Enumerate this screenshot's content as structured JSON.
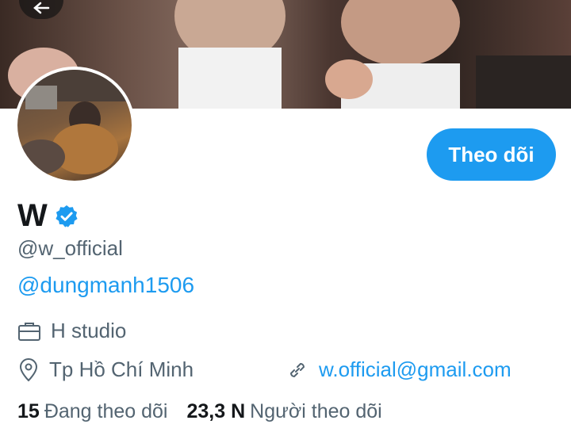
{
  "profile": {
    "name": "W",
    "handle": "@w_official",
    "bio_link": "@dungmanh1506",
    "work": "H studio",
    "location": "Tp Hồ Chí Minh",
    "website": "w.official@gmail.com",
    "follow_label": "Theo dõi",
    "following_count": "15",
    "following_label": "Đang theo dõi",
    "followers_count": "23,3 N",
    "followers_label": "Người theo dõi"
  },
  "colors": {
    "accent": "#1d9bf0",
    "muted": "#536471",
    "text": "#14171a"
  },
  "icons": [
    "back-arrow-icon",
    "verified-badge-icon",
    "briefcase-icon",
    "location-pin-icon",
    "link-icon"
  ]
}
